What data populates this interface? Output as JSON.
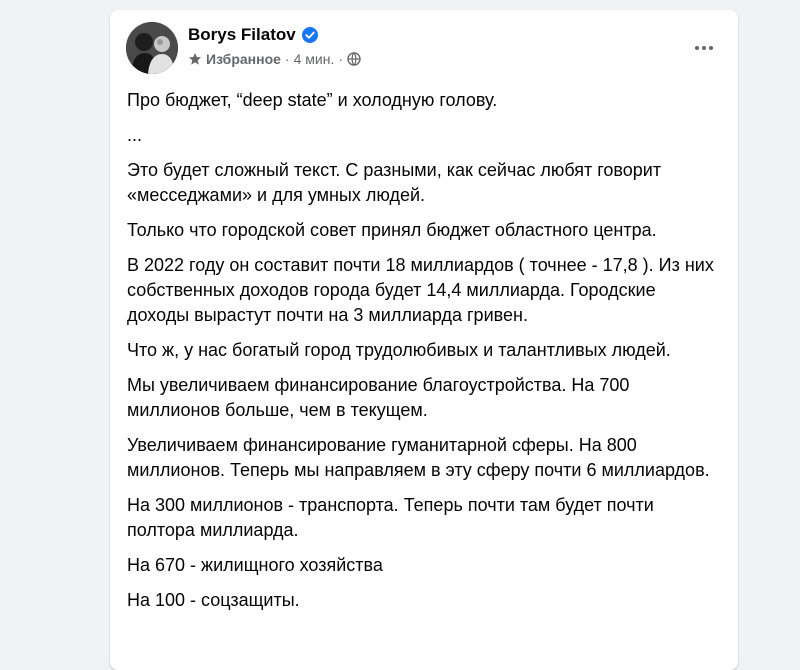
{
  "post": {
    "author": "Borys Filatov",
    "privacy": "Избранное",
    "separator": "·",
    "time": "4 мин.",
    "paragraphs": [
      "Про бюджет, “deep state” и холодную голову.",
      "...",
      "Это будет сложный текст. С разными, как сейчас любят говорит «месседжами» и для умных людей.",
      "Только что городской совет принял бюджет областного центра.",
      "В 2022 году он составит почти 18 миллиардов ( точнее - 17,8 ). Из них собственных доходов города будет 14,4 миллиарда. Городские доходы вырастут почти на 3 миллиарда гривен.",
      "Что ж, у нас богатый город трудолюбивых и талантливых людей.",
      "Мы увеличиваем финансирование благоустройства. На 700 миллионов больше, чем в текущем.",
      "Увеличиваем финансирование гуманитарной сферы. На 800 миллионов. Теперь мы направляем в эту сферу почти 6 миллиардов.",
      "На 300 миллионов - транспорта. Теперь почти там будет почти полтора миллиарда.",
      "На 670 - жилищного хозяйства",
      "На 100 - соцзащиты."
    ]
  },
  "icons": {
    "verified": "verified-badge-icon",
    "privacy": "star-icon",
    "audience": "globe-icon",
    "more": "more-options-icon"
  },
  "colors": {
    "background": "#f0f2f5",
    "card": "#ffffff",
    "text": "#050505",
    "secondary_text": "#65676b",
    "verified": "#1877f2"
  }
}
